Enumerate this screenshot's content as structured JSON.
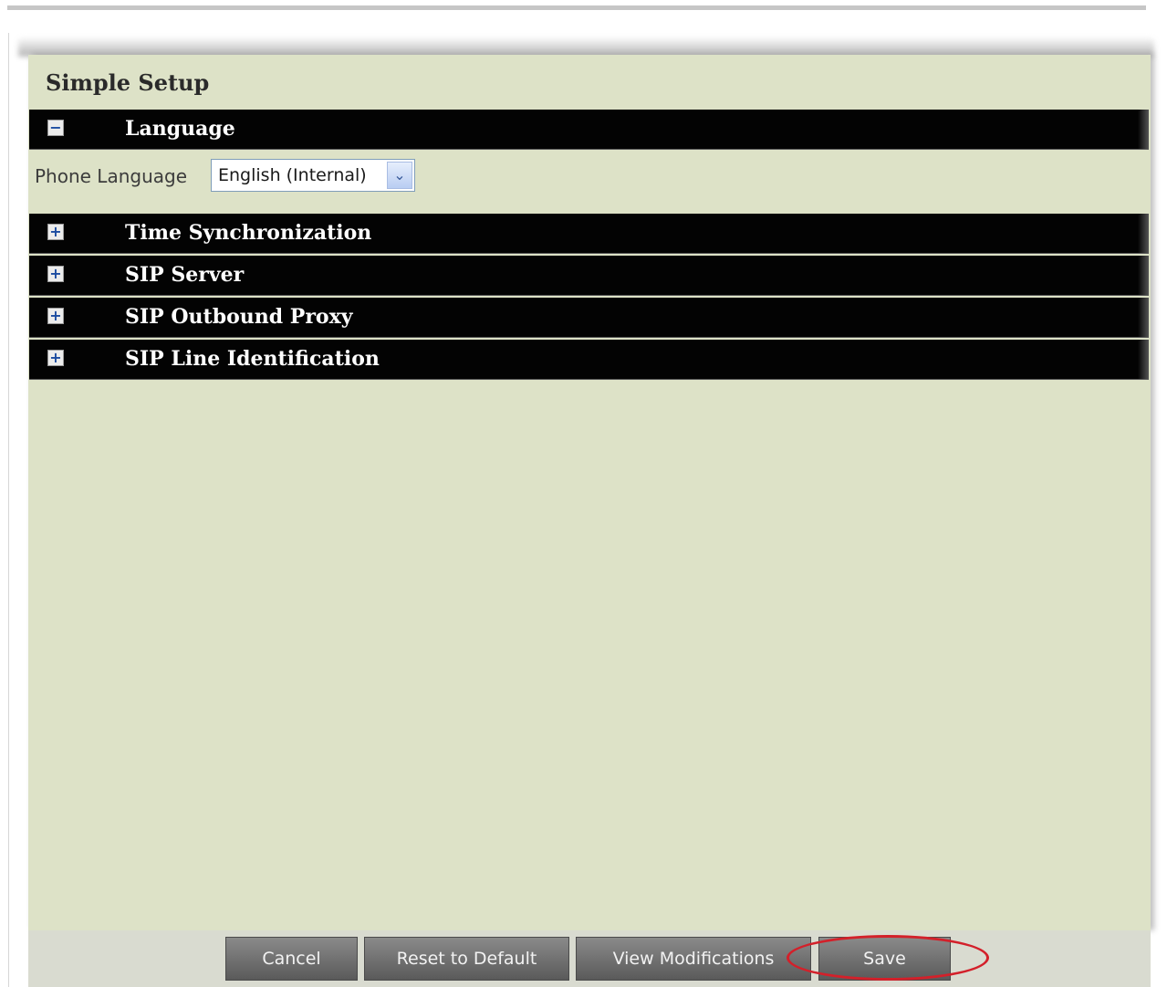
{
  "page": {
    "title": "Simple Setup"
  },
  "sections": [
    {
      "label": "Language",
      "expanded": true,
      "toggle_icon": "minus-box-icon",
      "toggle_symbol": "−"
    },
    {
      "label": "Time Synchronization",
      "expanded": false,
      "toggle_icon": "plus-box-icon",
      "toggle_symbol": "+"
    },
    {
      "label": "SIP Server",
      "expanded": false,
      "toggle_icon": "plus-box-icon",
      "toggle_symbol": "+"
    },
    {
      "label": "SIP Outbound Proxy",
      "expanded": false,
      "toggle_icon": "plus-box-icon",
      "toggle_symbol": "+"
    },
    {
      "label": "SIP Line Identification",
      "expanded": false,
      "toggle_icon": "plus-box-icon",
      "toggle_symbol": "+"
    }
  ],
  "language": {
    "field_label": "Phone Language",
    "selected_value": "English (Internal)",
    "dropdown_icon": "chevron-down-icon",
    "dropdown_symbol": "⌄"
  },
  "buttons": {
    "cancel": "Cancel",
    "reset": "Reset to Default",
    "view_modifications": "View Modifications",
    "save": "Save"
  },
  "colors": {
    "panel_background": "#dde2c7",
    "section_header": "#030303",
    "button": "#6f6f6f",
    "highlight_ring": "#d3202a"
  }
}
